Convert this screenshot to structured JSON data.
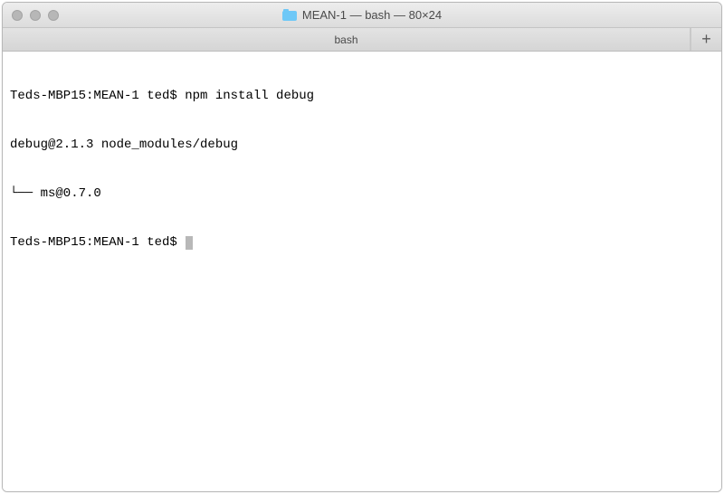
{
  "titlebar": {
    "window_title": "MEAN-1 — bash — 80×24"
  },
  "tabbar": {
    "tab_label": "bash",
    "new_tab_glyph": "+"
  },
  "terminal": {
    "lines": {
      "l0_prompt": "Teds-MBP15:MEAN-1 ted$ ",
      "l0_command": "npm install debug",
      "l1": "debug@2.1.3 node_modules/debug",
      "l2": "└── ms@0.7.0",
      "l3_prompt": "Teds-MBP15:MEAN-1 ted$ "
    }
  }
}
